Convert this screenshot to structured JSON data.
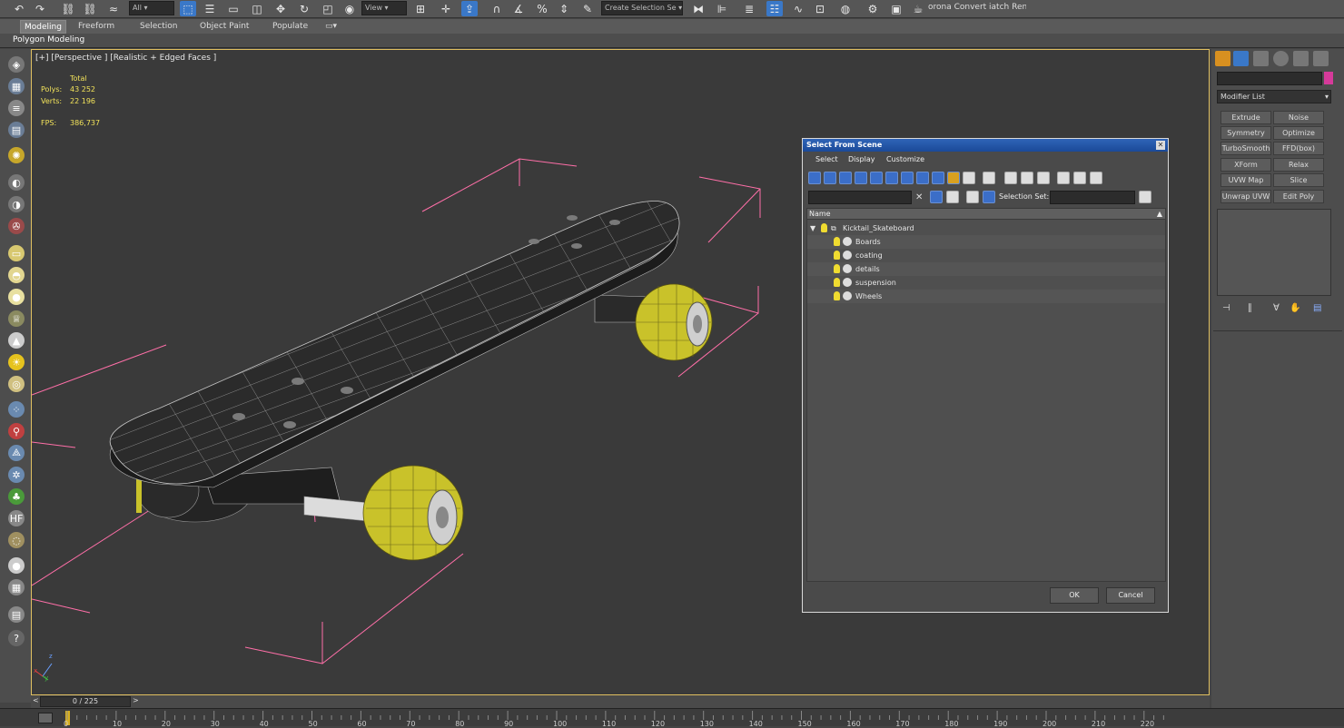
{
  "toolbar": {
    "selection_filter": "All",
    "ref_coord": "View",
    "named_selection": "Create Selection Se",
    "render_text": "orona Convert iatch Render..."
  },
  "ribbon": {
    "tabs": [
      "Modeling",
      "Freeform",
      "Selection",
      "Object Paint",
      "Populate"
    ],
    "active": "Modeling",
    "subtitle": "Polygon Modeling"
  },
  "viewport": {
    "label": "[+] [Perspective ] [Realistic + Edged Faces ]",
    "stats": {
      "total_label": "Total",
      "polys_label": "Polys:",
      "polys_value": "43 252",
      "verts_label": "Verts:",
      "verts_value": "22 196",
      "fps_label": "FPS:",
      "fps_value": "386,737"
    },
    "axis_labels": {
      "x": "x",
      "y": "y",
      "z": "z"
    }
  },
  "dialog": {
    "title": "Select From Scene",
    "close": "✕",
    "menu": [
      "Select",
      "Display",
      "Customize"
    ],
    "selection_set_label": "Selection Set:",
    "column_header": "Name",
    "root": "Kicktail_Skateboard",
    "children": [
      "Boards",
      "coating",
      "details",
      "suspension",
      "Wheels"
    ],
    "ok": "OK",
    "cancel": "Cancel"
  },
  "command_panel": {
    "modifier_list": "Modifier List",
    "modifiers": [
      [
        "Extrude",
        "Noise"
      ],
      [
        "Symmetry",
        "Optimize"
      ],
      [
        "TurboSmooth",
        "FFD(box)"
      ],
      [
        "XForm",
        "Relax"
      ],
      [
        "UVW Map",
        "Slice"
      ],
      [
        "Unwrap UVW",
        "Edit Poly"
      ]
    ],
    "accent_color": "#d63a9a"
  },
  "timeline": {
    "frame": "0 / 225",
    "prev": "<",
    "next": ">",
    "ticks": [
      "0",
      "10",
      "20",
      "30",
      "40",
      "50",
      "60",
      "70",
      "80",
      "90",
      "100",
      "110",
      "120",
      "130",
      "140",
      "150",
      "160",
      "170",
      "180",
      "190",
      "200",
      "210",
      "220"
    ]
  },
  "colors": {
    "viewport_bg": "#3a3a3a",
    "wireframe": "#a8a8a8",
    "wheel": "#c9c22a",
    "bbox": "#ff6fa8",
    "stats_text": "#f2e25a",
    "dialog_title": "#2f64b8"
  }
}
